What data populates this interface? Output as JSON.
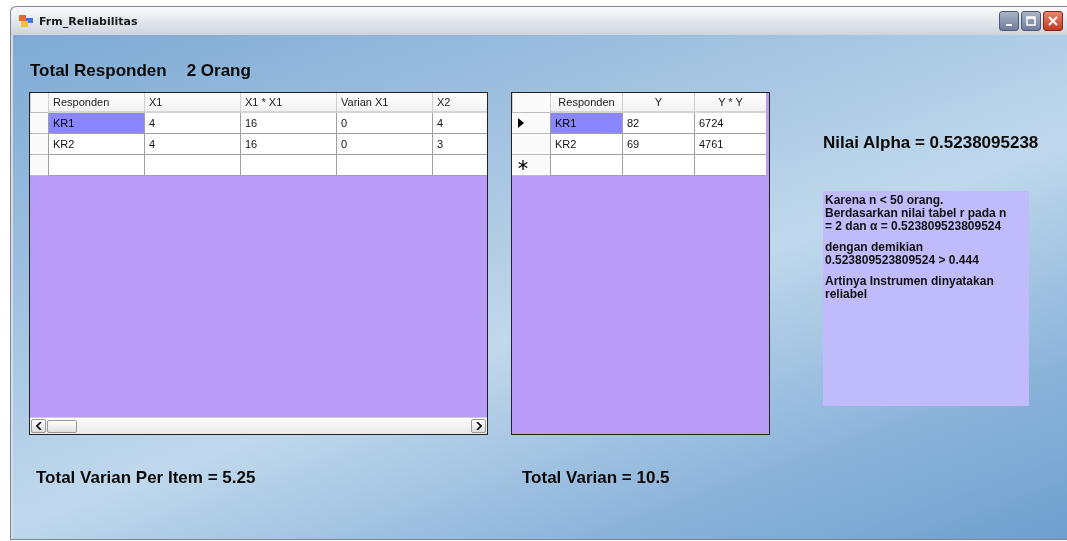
{
  "window": {
    "title": "Frm_Reliabilitas"
  },
  "total_responden": {
    "label": "Total Responden",
    "value": "2 Orang"
  },
  "grids": [
    {
      "columns": [
        "Responden",
        "X1",
        "X1 * X1",
        "Varian X1",
        "X2"
      ],
      "new_row_marker": false,
      "horizontal_scrollbar": true,
      "rows": [
        {
          "current": false,
          "cells": [
            {
              "text": "KR1",
              "selected": true
            },
            {
              "text": "4",
              "selected": false
            },
            {
              "text": "16",
              "selected": false
            },
            {
              "text": "0",
              "selected": false
            },
            {
              "text": "4",
              "selected": false
            }
          ]
        },
        {
          "current": false,
          "cells": [
            {
              "text": "KR2",
              "selected": false
            },
            {
              "text": "4",
              "selected": false
            },
            {
              "text": "16",
              "selected": false
            },
            {
              "text": "0",
              "selected": false
            },
            {
              "text": "3",
              "selected": false
            }
          ]
        }
      ]
    },
    {
      "columns": [
        "Responden",
        "Y",
        "Y * Y"
      ],
      "new_row_marker": true,
      "horizontal_scrollbar": false,
      "rows": [
        {
          "current": true,
          "cells": [
            {
              "text": "KR1",
              "selected": true
            },
            {
              "text": "82",
              "selected": false
            },
            {
              "text": "6724",
              "selected": false
            }
          ]
        },
        {
          "current": false,
          "cells": [
            {
              "text": "KR2",
              "selected": false
            },
            {
              "text": "69",
              "selected": false
            },
            {
              "text": "4761",
              "selected": false
            }
          ]
        }
      ]
    }
  ],
  "nilai_alpha": "Nilai Alpha = 0.5238095238",
  "conclusion": [
    [
      "Karena n < 50 orang.",
      "Berdasarkan nilai tabel r pada n = 2 dan α = 0.523809523809524"
    ],
    [
      "dengan demikian",
      "0.523809523809524 > 0.444"
    ],
    [
      "Artinya Instrumen dinyatakan reliabel"
    ]
  ],
  "total_varian_per_item": "Total Varian Per Item = 5.25",
  "total_varian": "Total Varian = 10.5"
}
